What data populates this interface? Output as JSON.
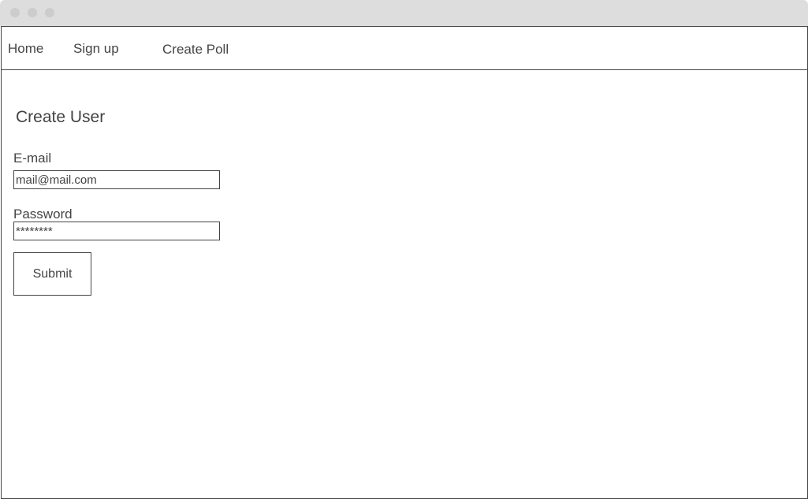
{
  "window": {
    "titlebar_color": "#dddddd",
    "border_color": "#444444",
    "text_color": "#444444"
  },
  "nav": {
    "items": [
      {
        "label": "Home"
      },
      {
        "label": "Sign up"
      },
      {
        "label": "Create Poll"
      }
    ]
  },
  "form": {
    "title": "Create User",
    "email": {
      "label": "E-mail",
      "value": "mail@mail.com"
    },
    "password": {
      "label": "Password",
      "value": "********"
    },
    "submit_label": "Submit"
  }
}
